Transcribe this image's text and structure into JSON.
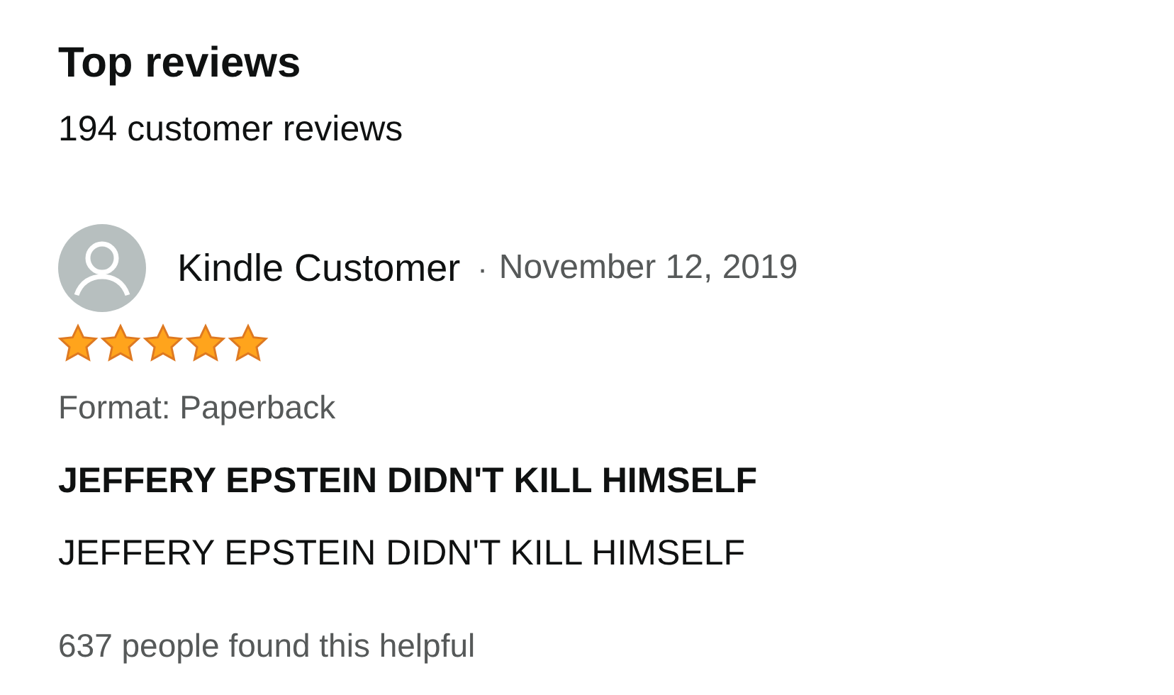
{
  "heading": "Top reviews",
  "review_count": "194 customer reviews",
  "reviews": [
    {
      "author": "Kindle Customer",
      "separator": "·",
      "date": "November 12, 2019",
      "stars": 5,
      "format": "Format: Paperback",
      "title": "JEFFERY EPSTEIN DIDN'T KILL HIMSELF",
      "body": "JEFFERY EPSTEIN DIDN'T KILL HIMSELF",
      "helpful": "637 people found this helpful"
    }
  ]
}
